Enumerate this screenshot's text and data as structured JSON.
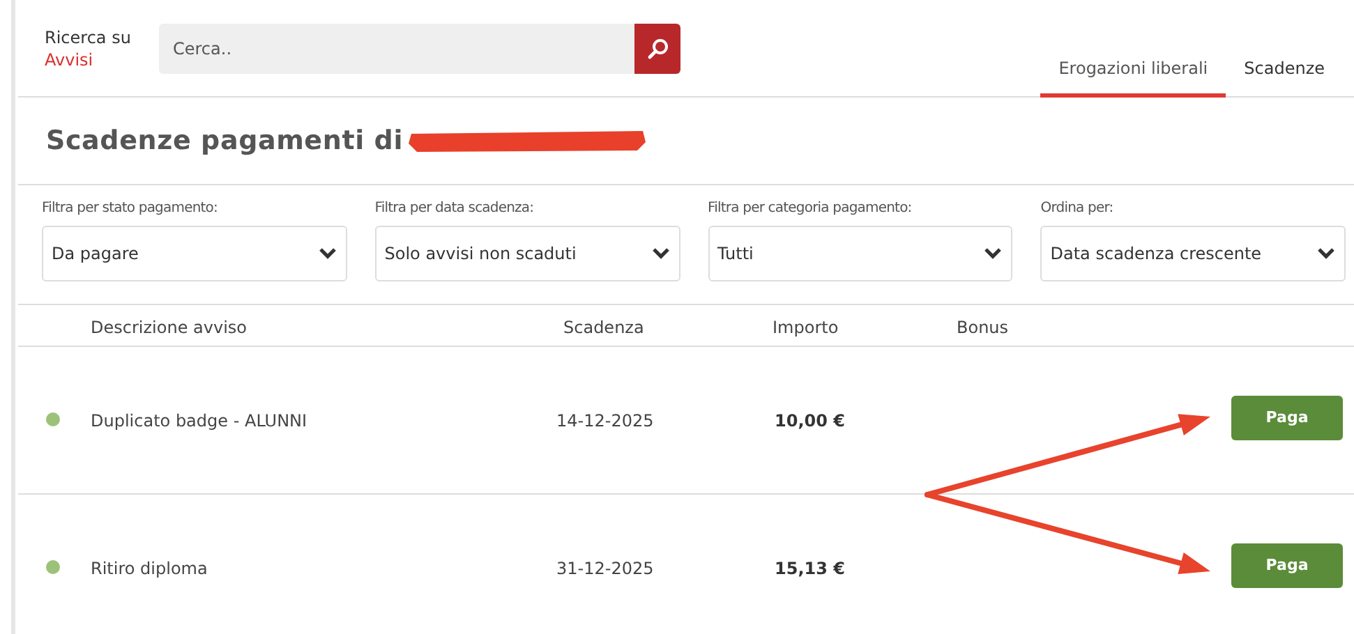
{
  "search": {
    "label": "Ricerca su",
    "scope": "Avvisi",
    "placeholder": "Cerca.."
  },
  "tabs": [
    {
      "label": "Erogazioni liberali",
      "selected": true
    },
    {
      "label": "Scadenze",
      "selected": false
    }
  ],
  "heading": {
    "title": "Scadenze pagamenti di",
    "name_redacted": true
  },
  "filters": [
    {
      "label": "Filtra per stato pagamento:",
      "value": "Da pagare"
    },
    {
      "label": "Filtra per data scadenza:",
      "value": "Solo avvisi non scaduti"
    },
    {
      "label": "Filtra per categoria pagamento:",
      "value": "Tutti"
    },
    {
      "label": "Ordina per:",
      "value": "Data scadenza crescente"
    }
  ],
  "table": {
    "columns": [
      "Descrizione avviso",
      "Scadenza",
      "Importo",
      "Bonus"
    ],
    "rows": [
      {
        "color": "#9cc27a",
        "description": "Duplicato badge - ALUNNI",
        "due_date": "14-12-2025",
        "amount": "10,00 €",
        "button": "Paga",
        "arrow_pointing": true
      },
      {
        "color": "#9cc27a",
        "description": "Ritiro diploma",
        "due_date": "31-12-2025",
        "amount": "15,13 €",
        "button": "Paga",
        "arrow_pointing": true
      }
    ]
  }
}
